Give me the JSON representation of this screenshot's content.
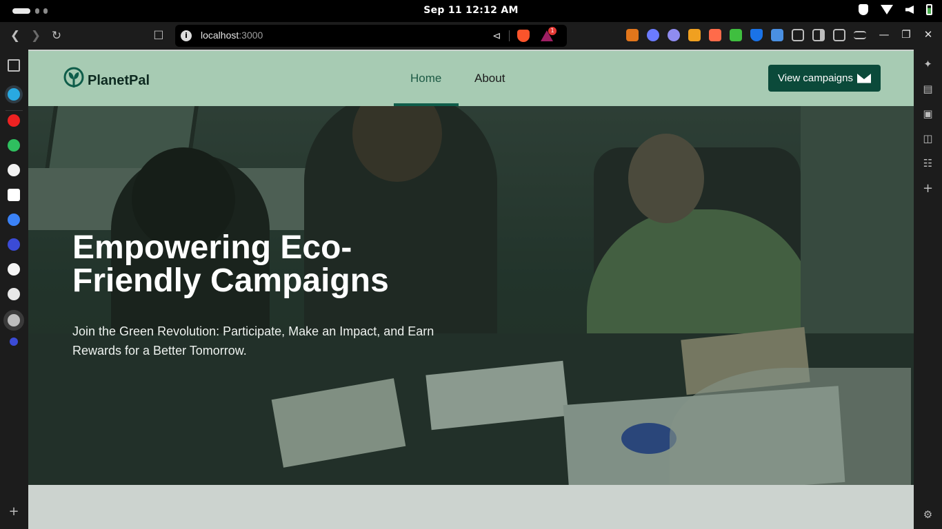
{
  "os": {
    "clock": "Sep 11  12:12 AM"
  },
  "browser": {
    "url_host": "localhost",
    "url_port": ":3000",
    "bat_badge": "1"
  },
  "site": {
    "brand": "PlanetPal",
    "nav": {
      "home": "Home",
      "about": "About"
    },
    "cta_label": "View campaigns",
    "hero": {
      "title": "Empowering Eco-Friendly Campaigns",
      "subtitle": "Join the Green Revolution: Participate, Make an Impact, and Earn Rewards for a Better Tomorrow."
    }
  },
  "colors": {
    "nav_bg": "#a7cbb3",
    "brand_dark": "#0b4a3a",
    "active_link": "#1d5a45",
    "page_bg": "#ccd3cf"
  },
  "icons": {
    "toolbar": [
      "back-icon",
      "forward-icon",
      "reload-icon",
      "bookmark-icon",
      "info-icon",
      "share-icon",
      "brave-shield-icon",
      "brave-rewards-icon"
    ],
    "window": [
      "minimize-icon",
      "maximize-icon",
      "close-icon"
    ],
    "left_sidebar": [
      "sidebar-toggle-icon",
      "leo-icon",
      "youtube-music-icon",
      "whatsapp-icon",
      "reddit-icon",
      "notion-icon",
      "copilot-icon",
      "extension-icon",
      "github-icon",
      "chatgpt-icon",
      "globe-icon",
      "extension-icon",
      "add-icon"
    ],
    "right_sidebar": [
      "ai-sparkle-icon",
      "video-icon",
      "wallet-icon",
      "bookmarks-icon",
      "reading-list-icon",
      "add-icon",
      "settings-icon"
    ]
  }
}
